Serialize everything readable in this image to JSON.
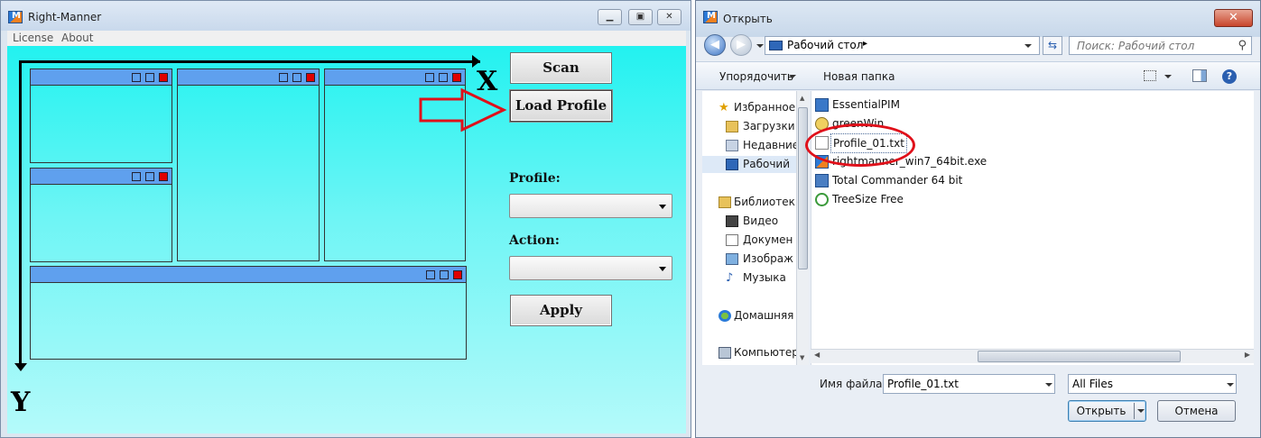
{
  "right_manner": {
    "title": "Right-Manner",
    "icon_letter": "M",
    "menu": [
      "License",
      "About"
    ],
    "axis_x": "X",
    "axis_y": "Y",
    "buttons": {
      "scan": "Scan",
      "load_profile": "Load Profile",
      "apply": "Apply"
    },
    "profile_label": "Profile:",
    "action_label": "Action:",
    "profile_value": "",
    "action_value": ""
  },
  "dialog": {
    "title": "Открыть",
    "close_glyph": "✕",
    "address": "Рабочий стол",
    "address_separator": "▸",
    "search_placeholder": "Поиск: Рабочий стол",
    "toolbar": {
      "organize": "Упорядочить",
      "new_folder": "Новая папка"
    },
    "nav_items": [
      {
        "label": "Избранное",
        "icon": "star-icon"
      },
      {
        "label": "Загрузки",
        "icon": "downloads-folder-icon"
      },
      {
        "label": "Недавние",
        "icon": "recent-places-icon"
      },
      {
        "label": "Рабочий",
        "icon": "desktop-icon"
      },
      {
        "label": "Библиотек",
        "icon": "libraries-icon"
      },
      {
        "label": "Видео",
        "icon": "video-icon"
      },
      {
        "label": "Докумен",
        "icon": "documents-icon"
      },
      {
        "label": "Изображ",
        "icon": "pictures-icon"
      },
      {
        "label": "Музыка",
        "icon": "music-icon"
      },
      {
        "label": "Домашняя",
        "icon": "homegroup-icon"
      },
      {
        "label": "Компьютер",
        "icon": "computer-icon"
      }
    ],
    "files": [
      {
        "name": "EssentialPIM",
        "icon": "shortcut-icon"
      },
      {
        "name": "greenWin",
        "icon": "shortcut-icon"
      },
      {
        "name": "Profile_01.txt",
        "icon": "text-file-icon"
      },
      {
        "name": "rightmanner_win7_64bit.exe",
        "icon": "shortcut-icon"
      },
      {
        "name": "Total Commander 64 bit",
        "icon": "shortcut-icon"
      },
      {
        "name": "TreeSize Free",
        "icon": "shortcut-icon"
      }
    ],
    "filename_label": "Имя файла:",
    "filename_value": "Profile_01.txt",
    "filetype_value": "All Files",
    "open_button": "Открыть",
    "cancel_button": "Отмена"
  },
  "colors": {
    "annotation_red": "#e0101a",
    "panel_blue": "#5fa0ee",
    "client_cyan": "#22f2f0"
  }
}
